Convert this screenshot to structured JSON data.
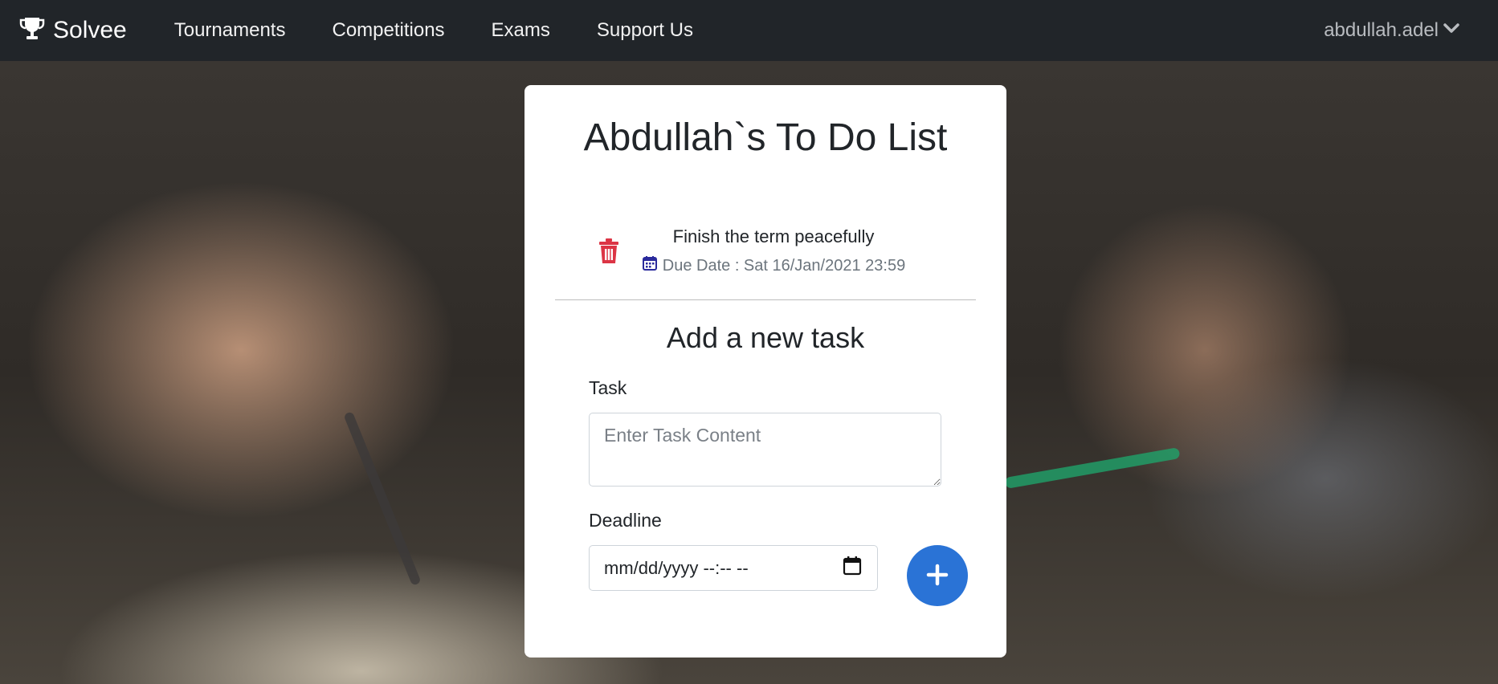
{
  "navbar": {
    "brand": "Solvee",
    "brand_icon": "trophy-icon",
    "links": [
      "Tournaments",
      "Competitions",
      "Exams",
      "Support Us"
    ],
    "user": "abdullah.adel",
    "user_icon": "chevron-down-icon"
  },
  "card": {
    "title": "Abdullah`s To Do List",
    "tasks": [
      {
        "text": "Finish the term peacefully",
        "due": "Due Date : Sat 16/Jan/2021 23:59"
      }
    ],
    "add_title": "Add a new task",
    "task_label": "Task",
    "task_placeholder": "Enter Task Content",
    "deadline_label": "Deadline",
    "deadline_placeholder": "mm/dd/yyyy --:-- --",
    "add_button_icon": "plus-icon"
  },
  "colors": {
    "navbar_bg": "#212529",
    "delete_red": "#dc3545",
    "calendar_blue": "#2a2a9c",
    "add_button_blue": "#2a73d6"
  }
}
